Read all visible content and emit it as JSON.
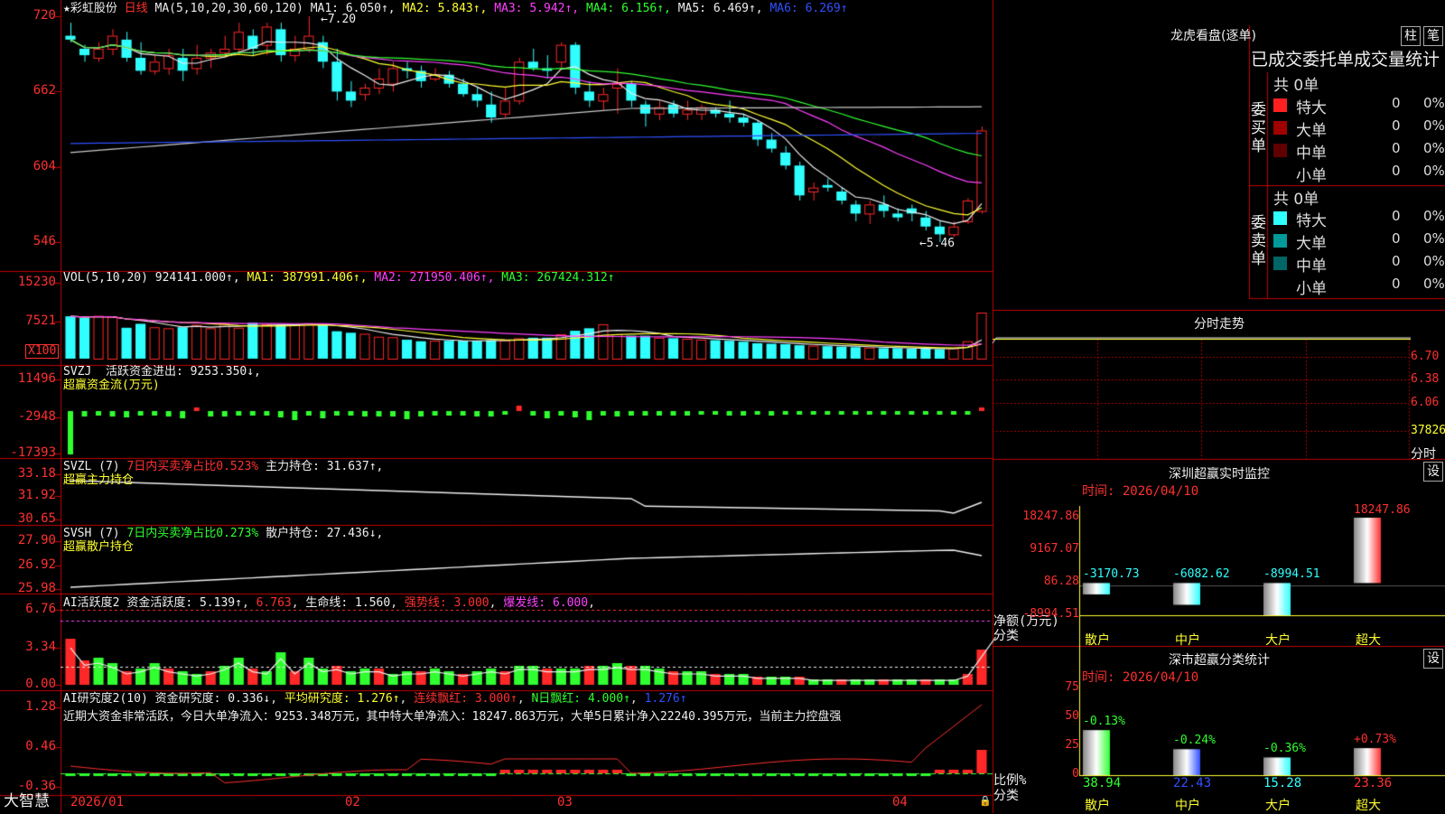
{
  "main": {
    "stock_name": "★彩虹股份",
    "period": "日线",
    "ma_label": "MA(5,10,20,30,60,120)",
    "ma_values": [
      {
        "name": "MA1",
        "value": "6.050↑",
        "color": "#eeeeee"
      },
      {
        "name": "MA2",
        "value": "5.843↑",
        "color": "#ffff30"
      },
      {
        "name": "MA3",
        "value": "5.942↑",
        "color": "#ff40ff"
      },
      {
        "name": "MA4",
        "value": "6.156↑",
        "color": "#30ff30"
      },
      {
        "name": "MA5",
        "value": "6.469↑",
        "color": "#eeeeee"
      },
      {
        "name": "MA6",
        "value": "6.269↑",
        "color": "#3050ff"
      }
    ],
    "y_ticks": [
      "720",
      "662",
      "604",
      "546"
    ],
    "high_mark": "7.20",
    "low_mark": "5.46"
  },
  "vol": {
    "label": "VOL(5,10,20)",
    "values": [
      {
        "text": "924141.000↑",
        "color": "#eeeeee"
      },
      {
        "text": "MA1: 387991.406↑",
        "color": "#ffff30"
      },
      {
        "text": "MA2: 271950.406↑",
        "color": "#ff40ff"
      },
      {
        "text": "MA3: 267424.312↑",
        "color": "#30ff30"
      }
    ],
    "y_ticks": [
      "15230",
      "7521"
    ],
    "unit": "X100"
  },
  "svzj": {
    "label": "SVZJ",
    "line1": "活跃资金进出: 9253.350↓,",
    "line2": "超赢资金流(万元)",
    "y_ticks": [
      "11496",
      "-2948",
      "-17393"
    ]
  },
  "svzl": {
    "label": "SVZL (7)",
    "ratio": "7日内买卖净占比0.523%",
    "hold": "主力持仓: 31.637↑,",
    "line2": "超赢主力持仓",
    "y_ticks": [
      "33.18",
      "31.92",
      "30.65"
    ]
  },
  "svsh": {
    "label": "SVSH (7)",
    "ratio": "7日内买卖净占比0.273%",
    "hold": "散户持仓: 27.436↓,",
    "line2": "超赢散户持仓",
    "y_ticks": [
      "27.90",
      "26.92",
      "25.98"
    ]
  },
  "ai1": {
    "label": "AI活跃度2",
    "v1": "资金活跃度: 5.139↑",
    "v2": "6.763",
    "v3": "生命线: 1.560",
    "v4": "强势线: 3.000",
    "v5": "爆发线: 6.000",
    "y_ticks": [
      "6.76",
      "3.34",
      "0.00"
    ]
  },
  "ai2": {
    "label": "AI研究度2(10)",
    "v1": "资金研究度: 0.336↓",
    "v2": "平均研究度: 1.276↑",
    "v3": "连续飘红: 3.000↑",
    "v4": "N日飘红: 4.000↑",
    "v5": "1.276↑",
    "summary": "近期大资金非常活跃，今日大单净流入：9253.348万元，其中特大单净流入：18247.863万元，大单5日累计净入22240.395万元，当前主力控盘强",
    "y_ticks": [
      "1.28",
      "0.46",
      "-0.36"
    ]
  },
  "x_axis": [
    "2026/01",
    "02",
    "03",
    "04"
  ],
  "brand": "大智慧",
  "longhu": {
    "title": "龙虎看盘(逐单)",
    "btn_zhu": "柱",
    "btn_bi": "笔",
    "header": "已成交委托单成交量统计",
    "buy_label": "委买单",
    "sell_label": "委卖单",
    "buy_total": "共 0单",
    "sell_total": "共 0单",
    "buy_rows": [
      {
        "name": "特大",
        "count": "0",
        "pct": "0%",
        "color": "#ff2020"
      },
      {
        "name": "大单",
        "count": "0",
        "pct": "0%",
        "color": "#a00000"
      },
      {
        "name": "中单",
        "count": "0",
        "pct": "0%",
        "color": "#600000"
      },
      {
        "name": "小单",
        "count": "0",
        "pct": "0%",
        "color": ""
      }
    ],
    "sell_rows": [
      {
        "name": "特大",
        "count": "0",
        "pct": "0%",
        "color": "#30ffff"
      },
      {
        "name": "大单",
        "count": "0",
        "pct": "0%",
        "color": "#009999"
      },
      {
        "name": "中单",
        "count": "0",
        "pct": "0%",
        "color": "#006666"
      },
      {
        "name": "小单",
        "count": "0",
        "pct": "0%",
        "color": ""
      }
    ]
  },
  "fenshi": {
    "title": "分时走势",
    "y_ticks": [
      "6.70",
      "6.38",
      "6.06",
      "37826"
    ],
    "unit": "分时"
  },
  "sz_monitor": {
    "title": "深圳超赢实时监控",
    "set": "设",
    "time": "时间: 2026/04/10",
    "y_ticks": [
      "18247.86",
      "9167.07",
      "86.28",
      "-8994.51"
    ],
    "axis_label1": "净额(万元)",
    "axis_label2": "分类",
    "categories": [
      "散户",
      "中户",
      "大户",
      "超大"
    ],
    "values": [
      -3170.73,
      -6082.62,
      -8994.51,
      18247.86
    ],
    "value_labels": [
      "-3170.73",
      "-6082.62",
      "-8994.51",
      "18247.86"
    ]
  },
  "sz_classify": {
    "title": "深市超赢分类统计",
    "set": "设",
    "time": "时间: 2026/04/10",
    "y_ticks": [
      "75",
      "50",
      "25",
      "0"
    ],
    "axis_label1": "比例%",
    "axis_label2": "分类",
    "categories": [
      "散户",
      "中户",
      "大户",
      "超大"
    ],
    "values": [
      38.94,
      22.43,
      15.28,
      23.36
    ],
    "value_labels": [
      "38.94",
      "22.43",
      "15.28",
      "23.36"
    ],
    "changes": [
      "-0.13%",
      "-0.24%",
      "-0.36%",
      "+0.73%"
    ],
    "change_colors": [
      "#30ff30",
      "#30ff30",
      "#30ff30",
      "#ff3030"
    ],
    "bar_colors": [
      "#30ff30",
      "#3050ff",
      "#30ffff",
      "#ff3030"
    ]
  },
  "chart_data": {
    "type": "candlestick",
    "candles": [
      [
        7.05,
        7.15,
        7.0,
        7.02
      ],
      [
        6.95,
        6.98,
        6.85,
        6.9
      ],
      [
        6.88,
        7.0,
        6.85,
        6.95
      ],
      [
        6.95,
        7.1,
        6.9,
        7.05
      ],
      [
        7.02,
        7.08,
        6.85,
        6.88
      ],
      [
        6.88,
        7.0,
        6.75,
        6.78
      ],
      [
        6.78,
        6.9,
        6.75,
        6.85
      ],
      [
        6.8,
        6.95,
        6.75,
        6.9
      ],
      [
        6.88,
        6.95,
        6.7,
        6.78
      ],
      [
        6.8,
        6.98,
        6.75,
        6.88
      ],
      [
        6.88,
        6.95,
        6.8,
        6.92
      ],
      [
        6.92,
        7.05,
        6.88,
        6.95
      ],
      [
        6.95,
        7.15,
        6.9,
        7.08
      ],
      [
        7.05,
        7.1,
        6.9,
        6.95
      ],
      [
        6.98,
        7.15,
        6.9,
        7.12
      ],
      [
        7.1,
        7.15,
        6.85,
        6.9
      ],
      [
        6.9,
        7.05,
        6.85,
        6.95
      ],
      [
        6.95,
        7.2,
        6.92,
        7.05
      ],
      [
        7.0,
        7.05,
        6.8,
        6.85
      ],
      [
        6.85,
        6.95,
        6.55,
        6.62
      ],
      [
        6.62,
        6.7,
        6.5,
        6.55
      ],
      [
        6.6,
        6.68,
        6.55,
        6.65
      ],
      [
        6.65,
        6.8,
        6.6,
        6.72
      ],
      [
        6.68,
        6.85,
        6.62,
        6.8
      ],
      [
        6.8,
        6.85,
        6.72,
        6.78
      ],
      [
        6.78,
        6.82,
        6.65,
        6.7
      ],
      [
        6.72,
        6.8,
        6.7,
        6.75
      ],
      [
        6.75,
        6.78,
        6.65,
        6.68
      ],
      [
        6.68,
        6.72,
        6.58,
        6.6
      ],
      [
        6.6,
        6.65,
        6.5,
        6.55
      ],
      [
        6.52,
        6.62,
        6.38,
        6.42
      ],
      [
        6.45,
        6.65,
        6.42,
        6.55
      ],
      [
        6.55,
        6.88,
        6.52,
        6.85
      ],
      [
        6.85,
        6.95,
        6.78,
        6.8
      ],
      [
        6.8,
        6.9,
        6.72,
        6.78
      ],
      [
        6.85,
        7.0,
        6.8,
        6.98
      ],
      [
        6.98,
        7.0,
        6.6,
        6.65
      ],
      [
        6.62,
        6.7,
        6.5,
        6.55
      ],
      [
        6.55,
        6.65,
        6.48,
        6.6
      ],
      [
        6.65,
        6.8,
        6.45,
        6.68
      ],
      [
        6.68,
        6.7,
        6.5,
        6.55
      ],
      [
        6.52,
        6.55,
        6.35,
        6.45
      ],
      [
        6.45,
        6.55,
        6.4,
        6.5
      ],
      [
        6.52,
        6.55,
        6.42,
        6.45
      ],
      [
        6.45,
        6.55,
        6.4,
        6.48
      ],
      [
        6.45,
        6.52,
        6.4,
        6.5
      ],
      [
        6.48,
        6.5,
        6.42,
        6.45
      ],
      [
        6.45,
        6.55,
        6.38,
        6.42
      ],
      [
        6.42,
        6.45,
        6.35,
        6.38
      ],
      [
        6.38,
        6.4,
        6.2,
        6.25
      ],
      [
        6.25,
        6.3,
        6.15,
        6.18
      ],
      [
        6.15,
        6.2,
        6.02,
        6.05
      ],
      [
        6.05,
        6.08,
        5.78,
        5.82
      ],
      [
        5.85,
        5.92,
        5.78,
        5.88
      ],
      [
        5.9,
        5.95,
        5.85,
        5.88
      ],
      [
        5.85,
        5.88,
        5.75,
        5.78
      ],
      [
        5.75,
        5.78,
        5.62,
        5.68
      ],
      [
        5.68,
        5.78,
        5.6,
        5.75
      ],
      [
        5.75,
        5.82,
        5.65,
        5.7
      ],
      [
        5.68,
        5.72,
        5.62,
        5.65
      ],
      [
        5.72,
        5.75,
        5.62,
        5.68
      ],
      [
        5.65,
        5.7,
        5.55,
        5.58
      ],
      [
        5.58,
        5.62,
        5.46,
        5.52
      ],
      [
        5.52,
        5.62,
        5.5,
        5.58
      ],
      [
        5.62,
        5.8,
        5.6,
        5.78
      ],
      [
        5.7,
        6.35,
        5.68,
        6.32
      ]
    ],
    "volume": [
      8500,
      8200,
      8600,
      8400,
      6200,
      7000,
      6300,
      6100,
      6300,
      6800,
      6100,
      7000,
      6200,
      7200,
      6900,
      6700,
      6900,
      7100,
      6900,
      5500,
      5200,
      5000,
      4400,
      4300,
      3800,
      3500,
      3600,
      3600,
      3600,
      3600,
      3700,
      3700,
      4100,
      4200,
      4200,
      4900,
      5600,
      6100,
      6900,
      4900,
      4600,
      4600,
      4200,
      4100,
      4000,
      3800,
      3700,
      3600,
      3400,
      3100,
      3000,
      2900,
      2700,
      2600,
      2500,
      2400,
      2300,
      2200,
      2100,
      2100,
      2000,
      2000,
      1900,
      2100,
      3500,
      9241
    ],
    "y_range": [
      5.3,
      7.3
    ]
  }
}
